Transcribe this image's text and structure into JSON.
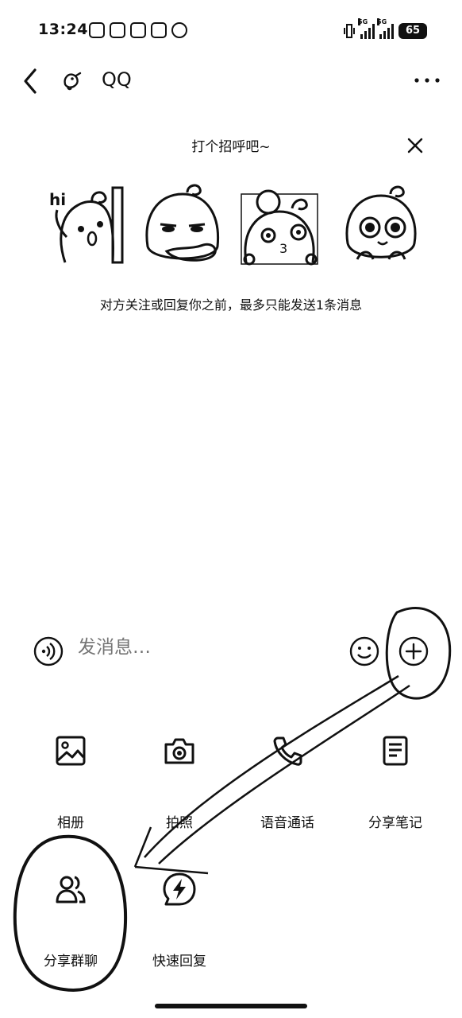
{
  "status_bar": {
    "time": "13:24",
    "network_1": "5G",
    "network_2": "5G",
    "battery": "65"
  },
  "nav": {
    "title": "QQ",
    "icons": [
      "back-icon",
      "qq-bird-icon",
      "more-icon"
    ]
  },
  "greeting": {
    "title": "打个招呼吧~",
    "notice": "对方关注或回复你之前，最多只能发送1条消息",
    "stickers": [
      "hi-sticker",
      "smug-sticker",
      "kiss-sticker",
      "big-eyes-sticker"
    ],
    "sticker_text": "hi"
  },
  "input": {
    "placeholder": "发消息…"
  },
  "panel": {
    "items": [
      {
        "label": "相册",
        "icon": "photo-album-icon"
      },
      {
        "label": "拍照",
        "icon": "camera-icon"
      },
      {
        "label": "语音通话",
        "icon": "phone-icon"
      },
      {
        "label": "分享笔记",
        "icon": "note-icon"
      },
      {
        "label": "分享群聊",
        "icon": "group-icon"
      },
      {
        "label": "快速回复",
        "icon": "lightning-icon"
      }
    ]
  }
}
